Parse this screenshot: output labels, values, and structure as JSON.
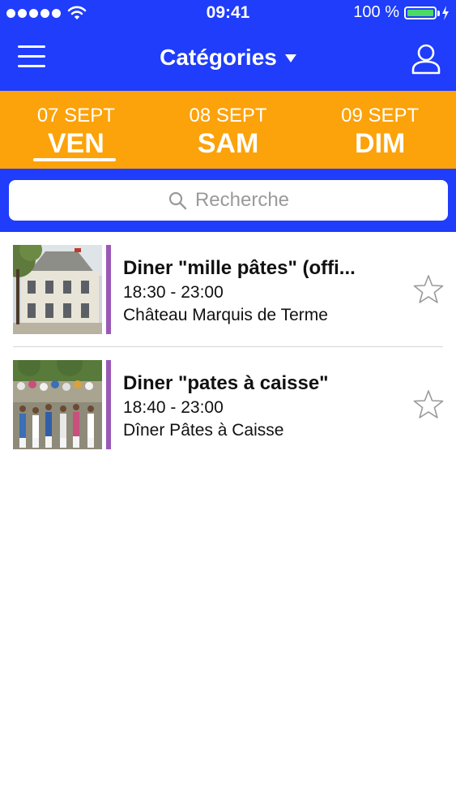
{
  "status_bar": {
    "time": "09:41",
    "battery_text": "100 %",
    "battery_level": 1.0,
    "icons": [
      "signal-dots-icon",
      "wifi-icon",
      "battery-icon",
      "charging-bolt-icon"
    ]
  },
  "nav": {
    "title": "Catégories",
    "menu_icon": "hamburger-menu-icon",
    "profile_icon": "user-icon",
    "dropdown_icon": "caret-down-icon"
  },
  "date_tabs": [
    {
      "date": "07 SEPT",
      "day": "VEN",
      "selected": true
    },
    {
      "date": "08 SEPT",
      "day": "SAM",
      "selected": false
    },
    {
      "date": "09 SEPT",
      "day": "DIM",
      "selected": false
    }
  ],
  "search": {
    "placeholder": "Recherche",
    "icon": "search-icon"
  },
  "events": [
    {
      "title": "Diner \"mille pâtes\" (offi...",
      "time": "18:30 - 23:00",
      "venue": "Château Marquis de Terme",
      "favorite_icon": "star-outline-icon",
      "category_color": "#9b59b6"
    },
    {
      "title": "Diner \"pates à caisse\"",
      "time": "18:40 - 23:00",
      "venue": "Dîner Pâtes à Caisse",
      "favorite_icon": "star-outline-icon",
      "category_color": "#9b59b6"
    }
  ],
  "colors": {
    "primary_blue": "#1f3dfa",
    "accent_orange": "#fca20a",
    "category_purple": "#9b59b6",
    "battery_green": "#4cd964"
  }
}
